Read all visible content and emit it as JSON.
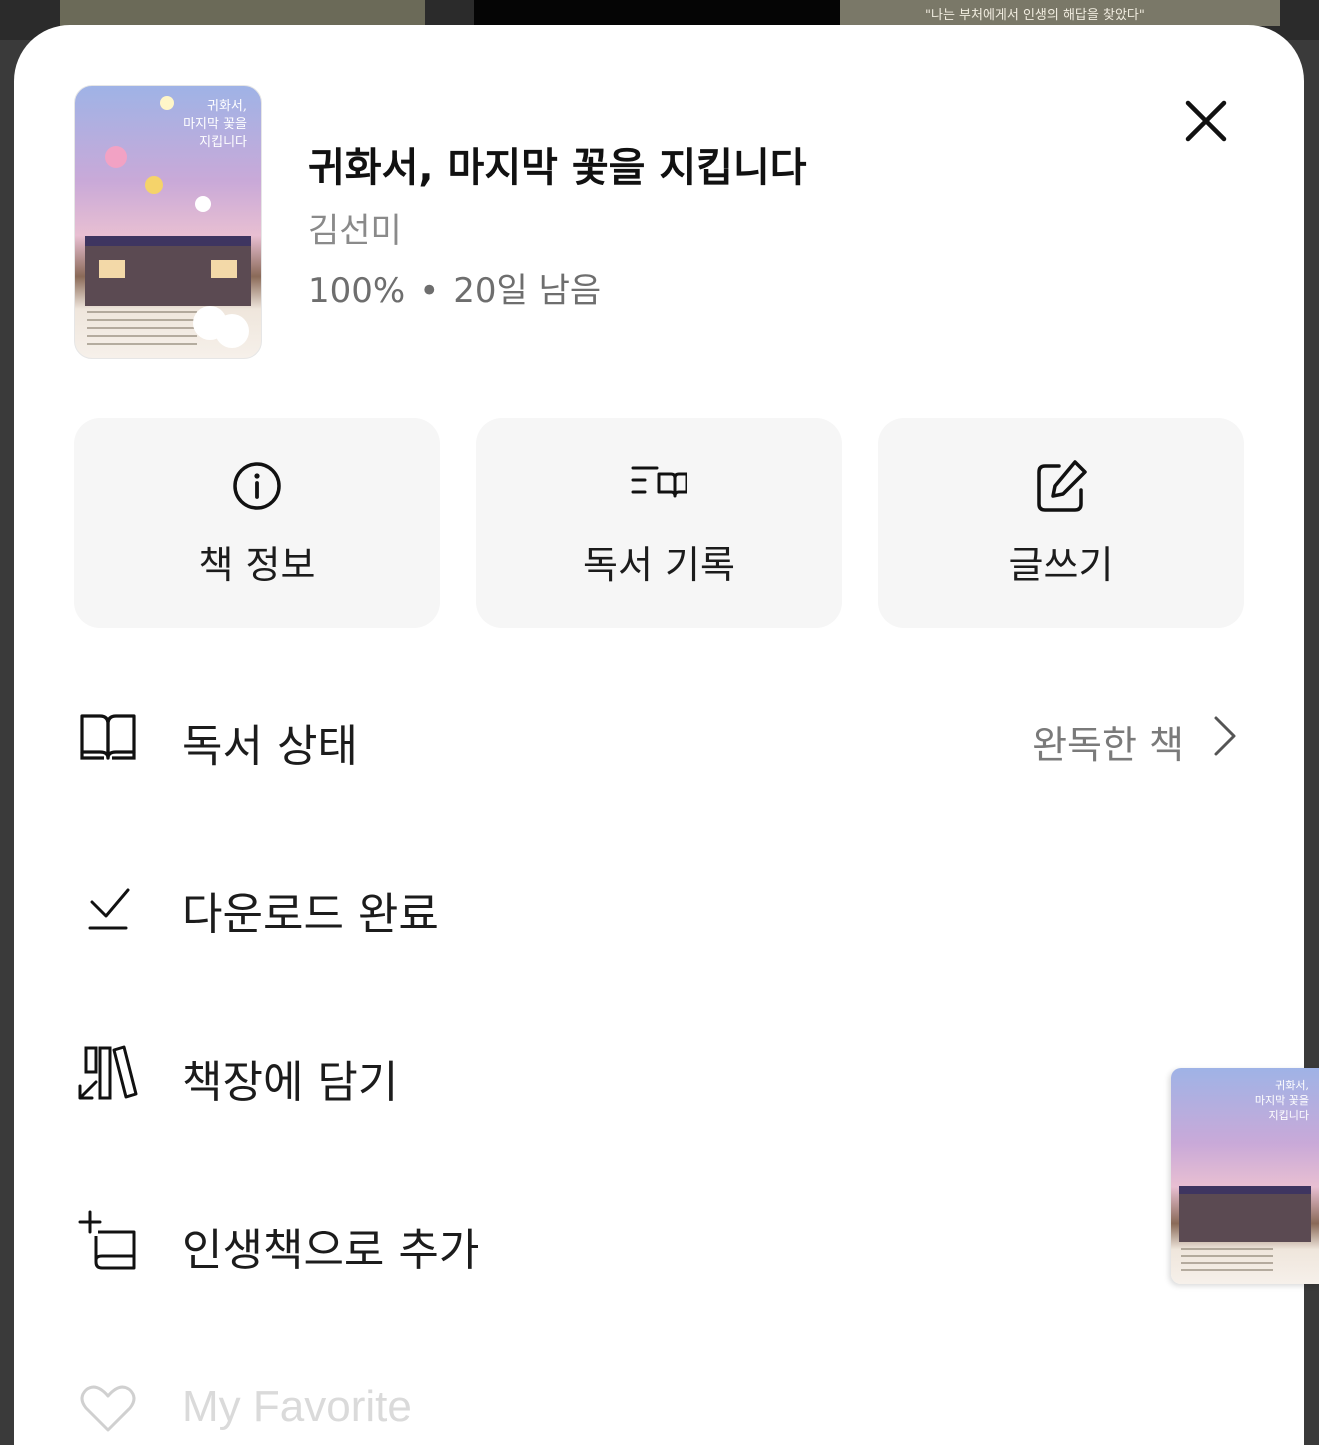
{
  "background": {
    "banner_text": "\"나는 부처에게서 인생의 해답을 찾았다\""
  },
  "book": {
    "cover_title_line1": "귀화서,",
    "cover_title_line2": "마지막 꽃을",
    "cover_title_line3": "지킵니다",
    "title": "귀화서, 마지막 꽃을 지킵니다",
    "author": "김선미",
    "progress": "100%",
    "separator": "•",
    "remaining": "20일 남음"
  },
  "actions": [
    {
      "label": "책 정보",
      "icon": "info-icon"
    },
    {
      "label": "독서 기록",
      "icon": "reading-log-icon"
    },
    {
      "label": "글쓰기",
      "icon": "edit-icon"
    }
  ],
  "menu": {
    "reading_status": {
      "label": "독서 상태",
      "value": "완독한 책",
      "icon": "open-book-icon"
    },
    "download": {
      "label": "다운로드 완료",
      "icon": "download-done-icon"
    },
    "bookshelf": {
      "label": "책장에 담기",
      "icon": "bookshelf-icon"
    },
    "life_book": {
      "label": "인생책으로 추가",
      "icon": "add-book-icon"
    },
    "favorite": {
      "label": "My Favorite",
      "icon": "heart-icon"
    }
  },
  "colors": {
    "sheet": "#ffffff",
    "card": "#f6f6f6",
    "text_primary": "#1c1c1c",
    "text_secondary": "#8a8a8a"
  }
}
